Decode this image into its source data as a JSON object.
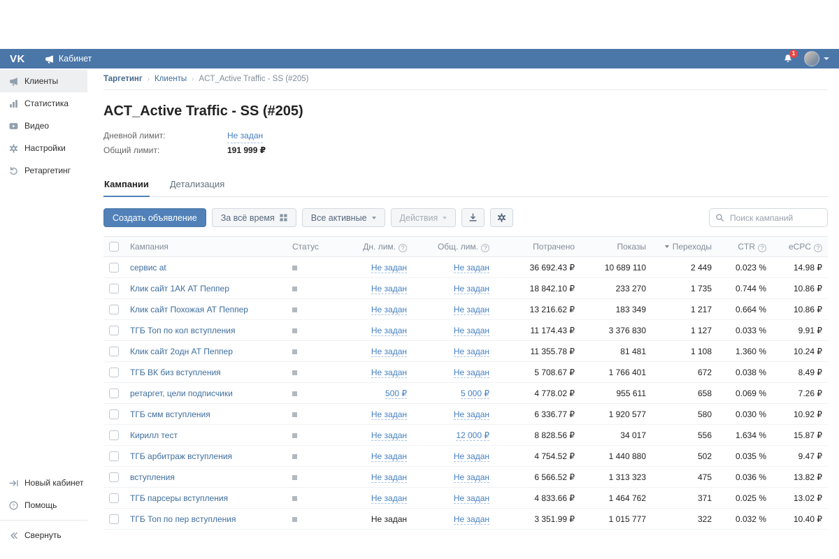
{
  "colors": {
    "header_bg": "#4a76a8",
    "accent_button": "#5181b8",
    "link": "#3e6e9e",
    "dashed_link": "#4680c2",
    "badge_red": "#e64646"
  },
  "header": {
    "logo": "VK",
    "app_title": "Кабинет",
    "notification_badge": "1"
  },
  "sidebar": {
    "items": [
      {
        "id": "clients",
        "label": "Клиенты",
        "icon": "megaphone-icon",
        "active": true
      },
      {
        "id": "statistics",
        "label": "Статистика",
        "icon": "bar-chart-icon",
        "active": false
      },
      {
        "id": "video",
        "label": "Видео",
        "icon": "video-icon",
        "active": false
      },
      {
        "id": "settings",
        "label": "Настройки",
        "icon": "gear-icon",
        "active": false
      },
      {
        "id": "retargeting",
        "label": "Ретаргетинг",
        "icon": "retargeting-icon",
        "active": false
      }
    ],
    "footer_items": [
      {
        "id": "new-cabinet",
        "label": "Новый кабинет",
        "icon": "arrow-right-icon",
        "divider_before": false
      },
      {
        "id": "help",
        "label": "Помощь",
        "icon": "question-icon",
        "divider_before": false
      },
      {
        "id": "collapse",
        "label": "Свернуть",
        "icon": "double-chevron-left-icon",
        "divider_before": true
      }
    ]
  },
  "breadcrumb": [
    "Таргетинг",
    "Клиенты",
    "ACT_Active Traffic - SS (#205)"
  ],
  "breadcrumb_separator": "›",
  "page": {
    "title": "ACT_Active Traffic - SS (#205)",
    "limits": [
      {
        "label": "Дневной лимит:",
        "value": "Не задан",
        "link": true
      },
      {
        "label": "Общий лимит:",
        "value": "191 999 ₽",
        "link": false
      }
    ]
  },
  "tabs": [
    {
      "id": "campaigns",
      "label": "Кампании",
      "active": true
    },
    {
      "id": "details",
      "label": "Детализация",
      "active": false
    }
  ],
  "toolbar": {
    "create_button": "Создать объявление",
    "period_button": "За всё время",
    "status_filter": "Все активные",
    "actions_button": "Действия",
    "search_placeholder": "Поиск кампаний"
  },
  "table": {
    "columns": [
      {
        "id": "campaign",
        "label": "Кампания",
        "align": "left",
        "width": null
      },
      {
        "id": "status",
        "label": "Статус",
        "align": "left",
        "width": 80
      },
      {
        "id": "daily_limit",
        "label": "Дн. лим.",
        "align": "right",
        "width": 100,
        "help": true
      },
      {
        "id": "total_limit",
        "label": "Общ. лим.",
        "align": "right",
        "width": 118,
        "help": true
      },
      {
        "id": "spent",
        "label": "Потрачено",
        "align": "right",
        "width": 122
      },
      {
        "id": "impressions",
        "label": "Показы",
        "align": "right",
        "width": 102
      },
      {
        "id": "clicks",
        "label": "Переходы",
        "align": "right",
        "width": 94,
        "sorted": "desc"
      },
      {
        "id": "ctr",
        "label": "CTR",
        "align": "right",
        "width": 78,
        "help": true
      },
      {
        "id": "ecpc",
        "label": "eCPC",
        "align": "right",
        "width": 80,
        "help": true
      }
    ],
    "rows": [
      {
        "name": "сервис at",
        "status": "stopped",
        "daily": "Не задан",
        "total": "Не задан",
        "spent": "36 692.43 ₽",
        "impressions": "10 689 110",
        "clicks": "2 449",
        "ctr": "0.023 %",
        "ecpc": "14.98 ₽"
      },
      {
        "name": "Клик сайт 1АК АТ Пеппер",
        "status": "stopped",
        "daily": "Не задан",
        "total": "Не задан",
        "spent": "18 842.10 ₽",
        "impressions": "233 270",
        "clicks": "1 735",
        "ctr": "0.744 %",
        "ecpc": "10.86 ₽"
      },
      {
        "name": "Клик сайт Похожая АТ Пеппер",
        "status": "stopped",
        "daily": "Не задан",
        "total": "Не задан",
        "spent": "13 216.62 ₽",
        "impressions": "183 349",
        "clicks": "1 217",
        "ctr": "0.664 %",
        "ecpc": "10.86 ₽"
      },
      {
        "name": "ТГБ Топ по кол вступления",
        "status": "stopped",
        "daily": "Не задан",
        "total": "Не задан",
        "spent": "11 174.43 ₽",
        "impressions": "3 376 830",
        "clicks": "1 127",
        "ctr": "0.033 %",
        "ecpc": "9.91 ₽"
      },
      {
        "name": "Клик сайт 2одн АТ Пеппер",
        "status": "stopped",
        "daily": "Не задан",
        "total": "Не задан",
        "spent": "11 355.78 ₽",
        "impressions": "81 481",
        "clicks": "1 108",
        "ctr": "1.360 %",
        "ecpc": "10.24 ₽"
      },
      {
        "name": "ТГБ ВК биз вступления",
        "status": "stopped",
        "daily": "Не задан",
        "total": "Не задан",
        "spent": "5 708.67 ₽",
        "impressions": "1 766 401",
        "clicks": "672",
        "ctr": "0.038 %",
        "ecpc": "8.49 ₽"
      },
      {
        "name": "ретаргет, цели подписчики",
        "status": "stopped",
        "daily": "500 ₽",
        "total": "5 000 ₽",
        "spent": "4 778.02 ₽",
        "impressions": "955 611",
        "clicks": "658",
        "ctr": "0.069 %",
        "ecpc": "7.26 ₽"
      },
      {
        "name": "ТГБ смм вступления",
        "status": "stopped",
        "daily": "Не задан",
        "total": "Не задан",
        "spent": "6 336.77 ₽",
        "impressions": "1 920 577",
        "clicks": "580",
        "ctr": "0.030 %",
        "ecpc": "10.92 ₽"
      },
      {
        "name": "Кирилл тест",
        "status": "stopped",
        "daily": "Не задан",
        "total": "12 000 ₽",
        "spent": "8 828.56 ₽",
        "impressions": "34 017",
        "clicks": "556",
        "ctr": "1.634 %",
        "ecpc": "15.87 ₽"
      },
      {
        "name": "ТГБ арбитраж вступления",
        "status": "stopped",
        "daily": "Не задан",
        "total": "Не задан",
        "spent": "4 754.52 ₽",
        "impressions": "1 440 880",
        "clicks": "502",
        "ctr": "0.035 %",
        "ecpc": "9.47 ₽"
      },
      {
        "name": "вступления",
        "status": "stopped",
        "daily": "Не задан",
        "total": "Не задан",
        "spent": "6 566.52 ₽",
        "impressions": "1 313 323",
        "clicks": "475",
        "ctr": "0.036 %",
        "ecpc": "13.82 ₽"
      },
      {
        "name": "ТГБ парсеры вступления",
        "status": "stopped",
        "daily": "Не задан",
        "total": "Не задан",
        "spent": "4 833.66 ₽",
        "impressions": "1 464 762",
        "clicks": "371",
        "ctr": "0.025 %",
        "ecpc": "13.02 ₽"
      },
      {
        "name": "ТГБ Топ по пер вступления",
        "status": "stopped",
        "daily": "Не задан",
        "daily_plain": true,
        "total": "Не задан",
        "spent": "3 351.99 ₽",
        "impressions": "1 015 777",
        "clicks": "322",
        "ctr": "0.032 %",
        "ecpc": "10.40 ₽"
      }
    ]
  }
}
